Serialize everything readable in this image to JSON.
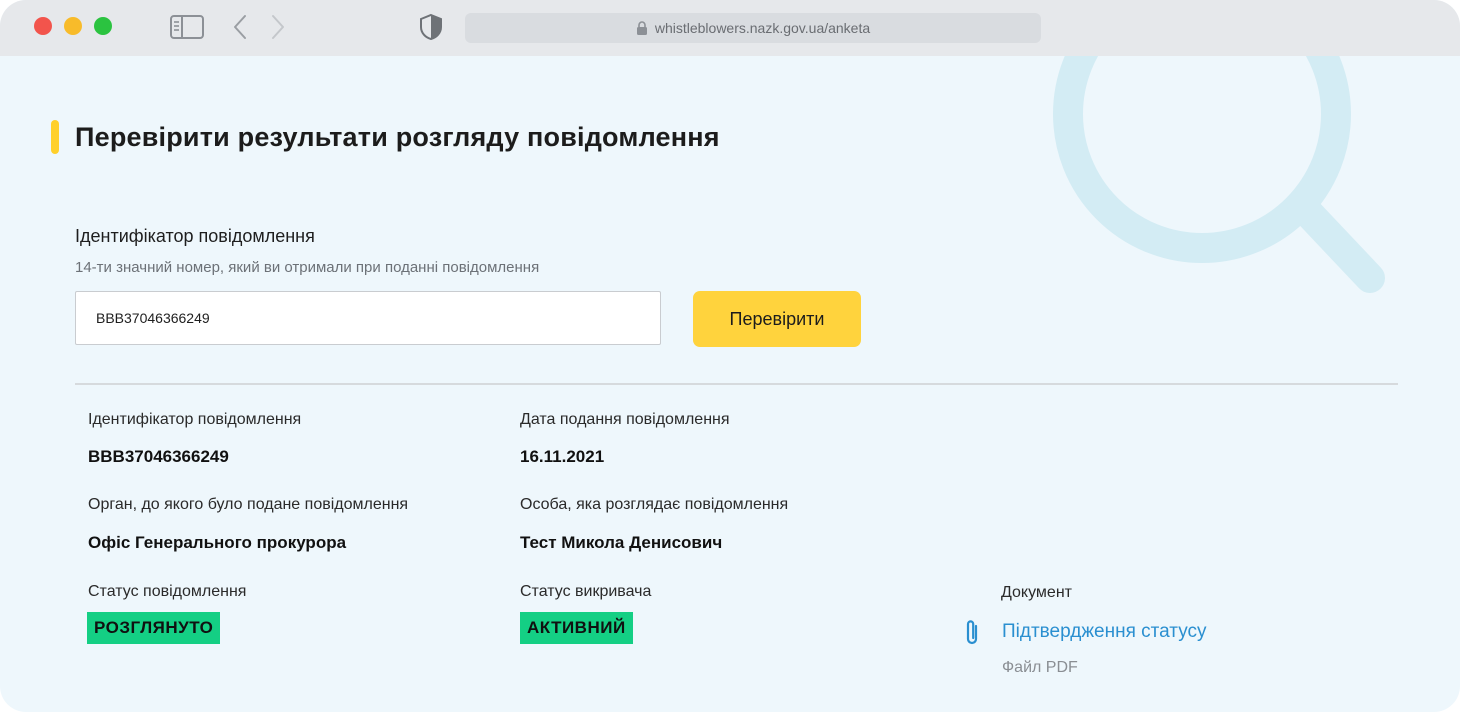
{
  "browser": {
    "url": "whistleblowers.nazk.gov.ua/anketa"
  },
  "page": {
    "title": "Перевірити результати розгляду повідомлення"
  },
  "form": {
    "label": "Ідентифікатор повідомлення",
    "hint": "14-ти значний номер, який ви отримали при поданні повідомлення",
    "input_value": "BBB37046366249",
    "button_label": "Перевірити"
  },
  "result": {
    "id_label": "Ідентифікатор повідомлення",
    "id_value": "BBB37046366249",
    "date_label": "Дата подання повідомлення",
    "date_value": "16.11.2021",
    "authority_label": "Орган, до якого було подане повідомлення",
    "authority_value": "Офіс Генерального прокурора",
    "reviewer_label": "Особа, яка розглядає повідомлення",
    "reviewer_value": "Тест Микола Денисович",
    "status_label": "Статус повідомлення",
    "status_value": "РОЗГЛЯНУТО",
    "whistleblower_status_label": "Статус викривача",
    "whistleblower_status_value": "АКТИВНИЙ",
    "document_label": "Документ",
    "document_link": "Підтвердження статусу",
    "document_type": "Файл PDF"
  },
  "colors": {
    "accent_yellow": "#ffd33d",
    "status_green": "#14cf84",
    "link_blue": "#2a8fd0",
    "background": "#eef7fc"
  },
  "icons": [
    "sidebar-toggle-icon",
    "back-arrow-icon",
    "forward-arrow-icon",
    "shield-icon",
    "lock-icon",
    "magnifier-icon",
    "paperclip-icon"
  ]
}
